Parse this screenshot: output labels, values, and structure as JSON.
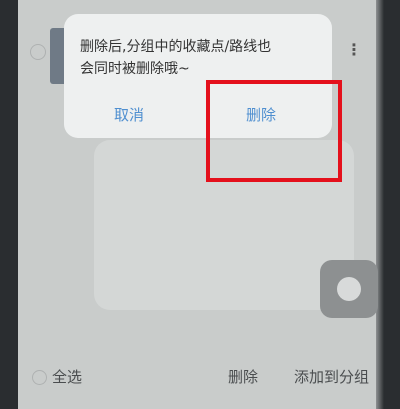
{
  "dialog": {
    "message_line1": "删除后,分组中的收藏点/路线也",
    "message_line2": "会同时被删除哦~",
    "cancel_label": "取消",
    "delete_label": "删除"
  },
  "bottom_bar": {
    "select_all_label": "全选",
    "delete_label": "删除",
    "add_to_group_label": "添加到分组"
  },
  "background": {
    "more_icon_glyph": "⋮"
  },
  "colors": {
    "highlight": "#e4101c",
    "dialog_button": "#4f8fd0"
  }
}
